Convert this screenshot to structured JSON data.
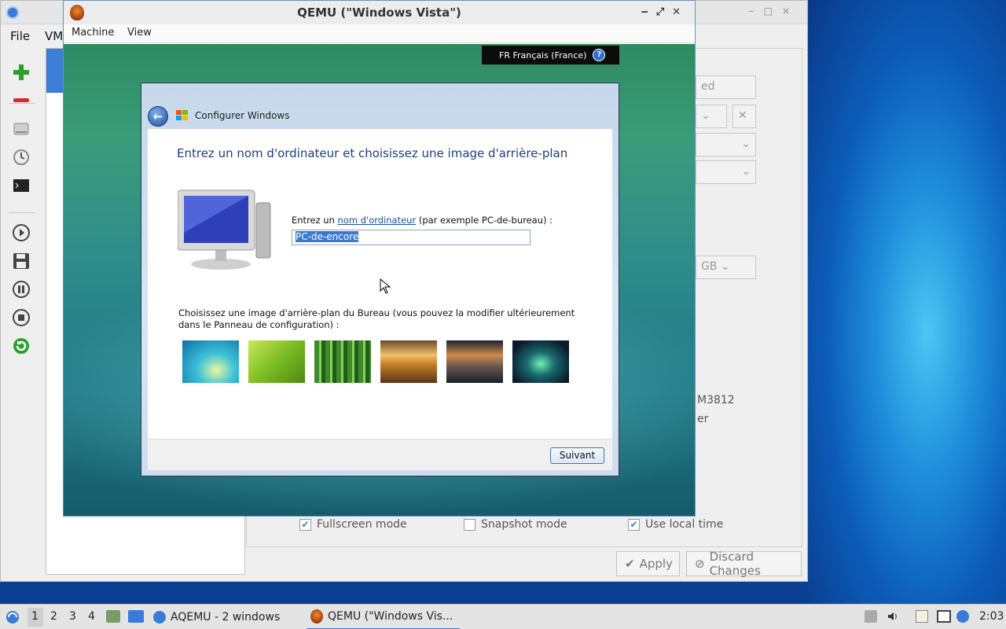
{
  "aqemu": {
    "menu": [
      "File",
      "VM"
    ],
    "right_fragments": [
      "ed",
      "GB",
      "M3812",
      "er"
    ],
    "checkboxes": [
      {
        "label": "Fullscreen mode",
        "checked": true
      },
      {
        "label": "Snapshot mode",
        "checked": false
      },
      {
        "label": "Use local time",
        "checked": true
      }
    ],
    "apply_label": "Apply",
    "discard_label": "Discard Changes"
  },
  "qemu": {
    "title": "QEMU (\"Windows Vista\")",
    "menu": [
      "Machine",
      "View"
    ],
    "langbar": "FR Français (France)"
  },
  "setup": {
    "window_title": "Configurer Windows",
    "heading": "Entrez un nom d'ordinateur et choisissez une image d'arrière-plan",
    "name_label_pre": "Entrez un ",
    "name_label_link": "nom d'ordinateur",
    "name_label_post": " (par exemple PC-de-bureau) :",
    "computer_name": "PC-de-encore",
    "bg_label": "Choisissez une image d'arrière-plan du Bureau (vous pouvez la modifier ultérieurement dans le Panneau de configuration) :",
    "next_label": "Suivant",
    "wallpapers": [
      "aurora-glow",
      "green-leaf",
      "bamboo",
      "sunset-field",
      "mountain-lake",
      "northern-lights"
    ]
  },
  "taskbar": {
    "workspaces": [
      "1",
      "2",
      "3",
      "4"
    ],
    "tasks": [
      "AQEMU - 2 windows",
      "QEMU (\"Windows Vis..."
    ],
    "clock": "2:03"
  },
  "colors": {
    "accent": "#3d7ed6",
    "vista_heading": "#1d3f7a"
  }
}
